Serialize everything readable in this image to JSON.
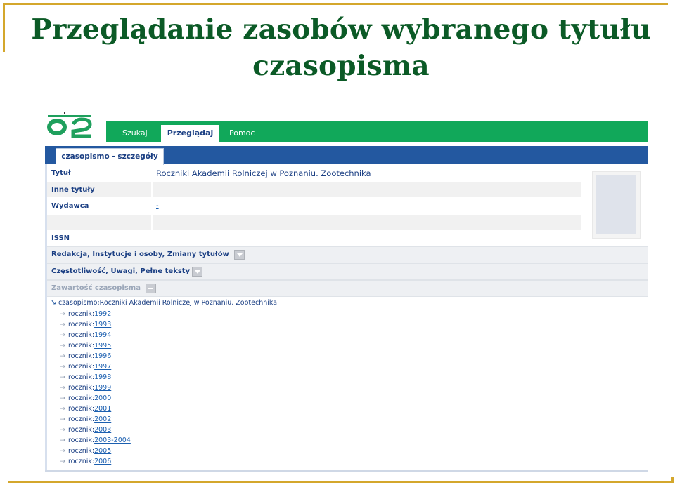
{
  "slide": {
    "title_line1": "Przeglądanie zasobów wybranego tytułu",
    "title_line2": "czasopisma",
    "accent_color": "#d4a72c",
    "title_color": "#0b5a26"
  },
  "app": {
    "logo_icon": "logo-icon",
    "nav": {
      "tabs": [
        "Szukaj",
        "Przeglądaj",
        "Pomoc"
      ],
      "active_index": 1,
      "bar_color": "#11a85a"
    },
    "subtab": {
      "label": "czasopismo - szczegóły",
      "bar_color": "#2358a0"
    },
    "details": {
      "title_label": "Tytuł",
      "title_value": "Roczniki Akademii Rolniczej w Poznaniu. Zootechnika",
      "other_titles_label": "Inne tytuły",
      "publisher_label": "Wydawca",
      "publisher_value": "-",
      "issn_label": "ISSN"
    },
    "sections": [
      {
        "label": "Redakcja, Instytucje i osoby, Zmiany tytułów",
        "icon": "dropdown-icon"
      },
      {
        "label": "Częstotliwość, Uwagi, Pełne teksty",
        "icon": "dropdown-icon"
      },
      {
        "label": "Zawartość czasopisma",
        "icon": "collapse-icon"
      }
    ],
    "tree": {
      "root": "czasopismo:Roczniki Akademii Rolniczej w Poznaniu. Zootechnika",
      "item_prefix": "rocznik:",
      "years": [
        "1992",
        "1993",
        "1994",
        "1995",
        "1996",
        "1997",
        "1998",
        "1999",
        "2000",
        "2001",
        "2002",
        "2003",
        "2003-2004",
        "2005",
        "2006"
      ]
    }
  }
}
